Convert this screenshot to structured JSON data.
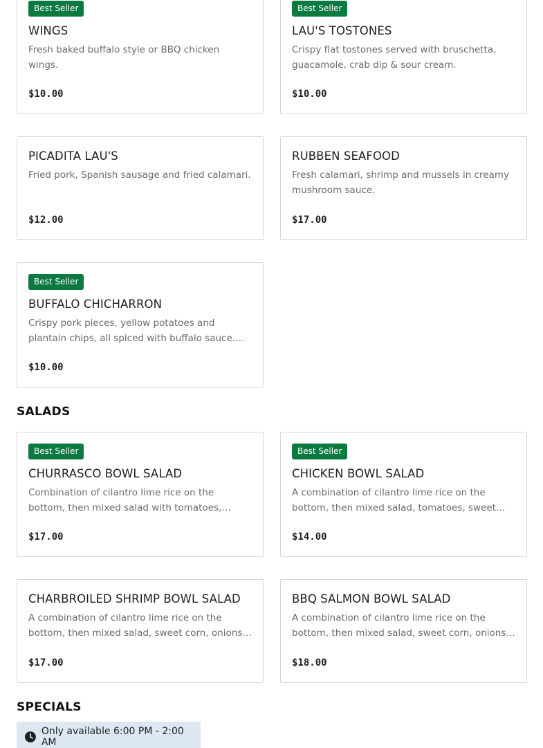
{
  "sections": {
    "salads_heading": "SALADS",
    "specials_heading": "SPECIALS"
  },
  "specials_availability": "Only available 6:00 PM - 2:00 AM",
  "colors": {
    "badge_bg": "#0a7a41",
    "availability_bg": "#dde7f2",
    "card_border": "#d6d6d6"
  },
  "items": [
    {
      "badge": "Best Seller",
      "name": "WINGS",
      "description": "Fresh baked buffalo style or BBQ chicken wings.",
      "price": "$10.00"
    },
    {
      "badge": "Best Seller",
      "name": "LAU'S TOSTONES",
      "description": "Crispy flat tostones served with bruschetta, guacamole, crab dip & sour cream.",
      "price": "$10.00"
    },
    {
      "badge": "",
      "name": "PICADITA LAU'S",
      "description": "Fried pork, Spanish sausage and fried calamari.",
      "price": "$12.00"
    },
    {
      "badge": "",
      "name": "RUBBEN SEAFOOD",
      "description": "Fresh calamari, shrimp and mussels in creamy mushroom sauce.",
      "price": "$17.00"
    },
    {
      "badge": "Best Seller",
      "name": "BUFFALO CHICHARRON",
      "description": "Crispy pork pieces, yellow potatoes and plantain chips, all spiced with buffalo sauce. Ask for BB...",
      "price": "$10.00"
    },
    {
      "badge": "Best Seller",
      "name": "CHURRASCO BOWL SALAD",
      "description": "Combination of cilantro lime rice on the bottom, then mixed salad with tomatoes, onions, sweet...",
      "price": "$17.00"
    },
    {
      "badge": "Best Seller",
      "name": "CHICKEN BOWL SALAD",
      "description": "A combination of cilantro lime rice on the bottom, then mixed salad, tomatoes, sweet corn, onions,...",
      "price": "$14.00"
    },
    {
      "badge": "",
      "name": "CHARBROILED SHRIMP BOWL SALAD",
      "description": "A combination of cilantro lime rice on the bottom, then mixed salad, sweet corn, onions, tomatoes,...",
      "price": "$17.00"
    },
    {
      "badge": "",
      "name": "BBQ SALMON BOWL SALAD",
      "description": "A combination of cilantro lime rice on the bottom, then mixed salad, sweet corn, onions, tomatoes,...",
      "price": "$18.00"
    }
  ]
}
